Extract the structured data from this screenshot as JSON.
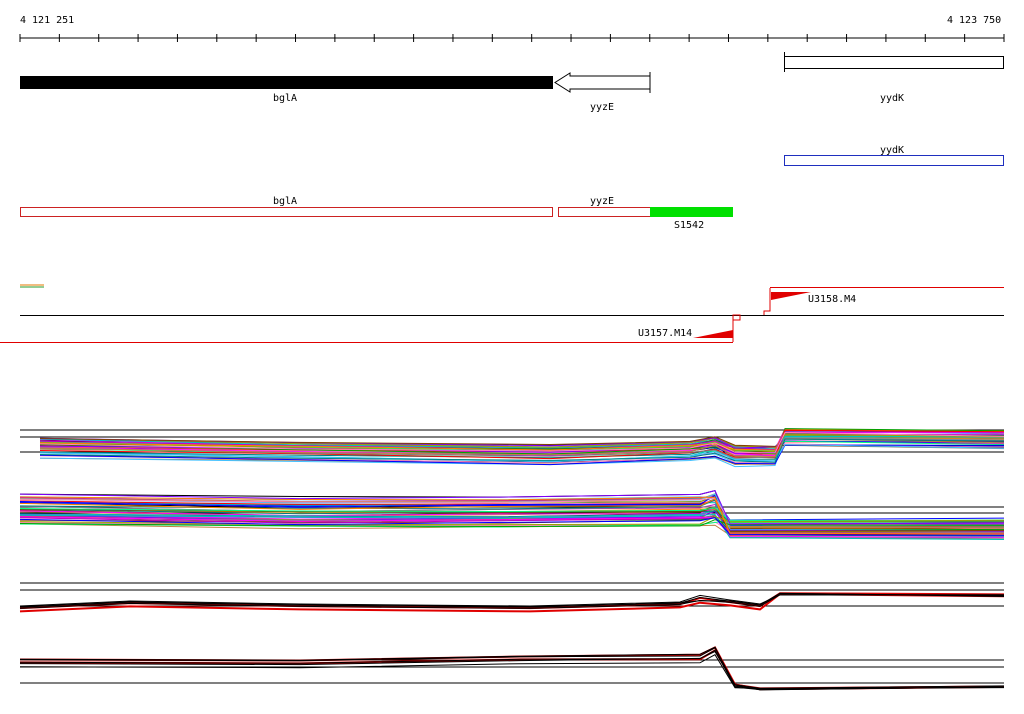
{
  "ruler": {
    "start_label": "4 121 251",
    "end_label": "4 123 750"
  },
  "genes": {
    "bglA": "bglA",
    "yyzE": "yyzE",
    "yydK": "yydK"
  },
  "annotation_row": {
    "yydK": "yydK",
    "bglA": "bglA",
    "yyzE": "yyzE",
    "S1542": "S1542"
  },
  "segments": {
    "left_label": "U3157.M14",
    "right_label": "U3158.M4"
  },
  "colors": {
    "gene_black": "#000000",
    "annotation_red": "#cc2222",
    "annotation_blue": "#1f2fbf",
    "highlight_green": "#00e000",
    "segment_red": "#e00000"
  }
}
